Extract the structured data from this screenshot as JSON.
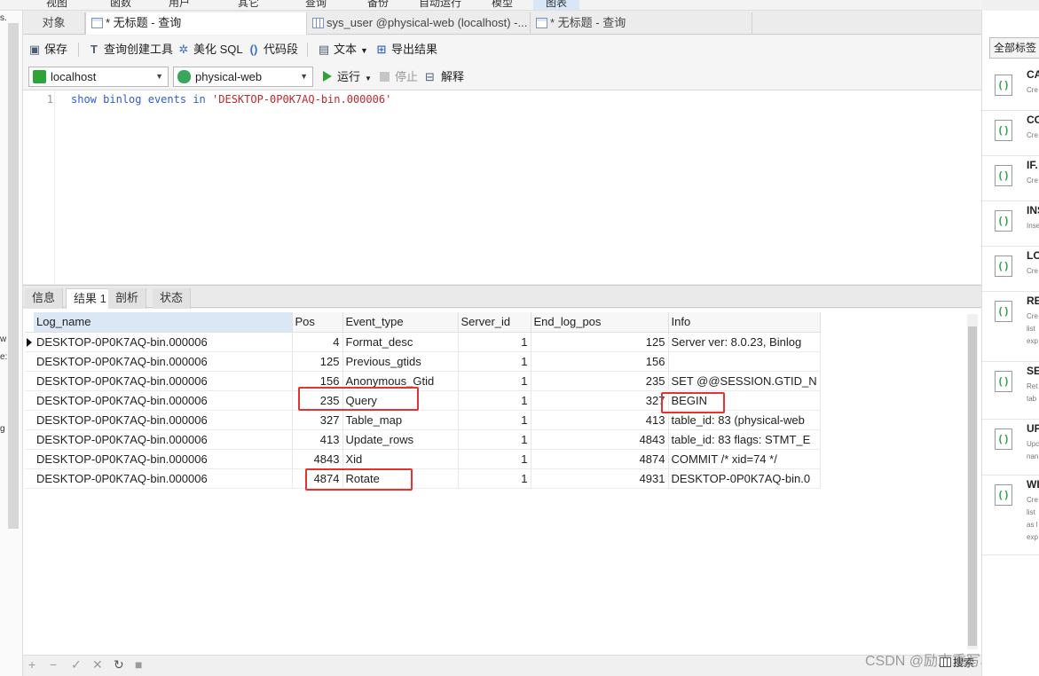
{
  "menu": [
    "视图",
    "函数",
    "用户",
    "其它",
    "查询",
    "备份",
    "自动运行",
    "模型",
    "图表"
  ],
  "tabs": [
    {
      "label": "对象"
    },
    {
      "label": "* 无标题 - 查询"
    },
    {
      "label": "sys_user @physical-web (localhost) -..."
    },
    {
      "label": "* 无标题 - 查询"
    }
  ],
  "toolbar": {
    "save": "保存",
    "query_builder": "查询创建工具",
    "beautify": "美化 SQL",
    "snippet": "代码段",
    "text": "文本",
    "export": "导出结果"
  },
  "connection": {
    "server": "localhost",
    "database": "physical-web",
    "run": "运行",
    "stop": "停止",
    "explain": "解释"
  },
  "editor": {
    "line_number": "1",
    "kw1": "show",
    "kw2": "binlog",
    "kw3": "events",
    "kw4": "in",
    "str": "'DESKTOP-0P0K7AQ-bin.000006'"
  },
  "result_tabs": [
    "信息",
    "结果 1",
    "剖析",
    "状态"
  ],
  "grid": {
    "columns": [
      "Log_name",
      "Pos",
      "Event_type",
      "Server_id",
      "End_log_pos",
      "Info"
    ],
    "rows": [
      [
        "DESKTOP-0P0K7AQ-bin.000006",
        "4",
        "Format_desc",
        "1",
        "125",
        "Server ver: 8.0.23, Binlog"
      ],
      [
        "DESKTOP-0P0K7AQ-bin.000006",
        "125",
        "Previous_gtids",
        "1",
        "156",
        ""
      ],
      [
        "DESKTOP-0P0K7AQ-bin.000006",
        "156",
        "Anonymous_Gtid",
        "1",
        "235",
        "SET @@SESSION.GTID_N"
      ],
      [
        "DESKTOP-0P0K7AQ-bin.000006",
        "235",
        "Query",
        "1",
        "327",
        "BEGIN"
      ],
      [
        "DESKTOP-0P0K7AQ-bin.000006",
        "327",
        "Table_map",
        "1",
        "413",
        "table_id: 83 (physical-web"
      ],
      [
        "DESKTOP-0P0K7AQ-bin.000006",
        "413",
        "Update_rows",
        "1",
        "4843",
        "table_id: 83 flags: STMT_E"
      ],
      [
        "DESKTOP-0P0K7AQ-bin.000006",
        "4843",
        "Xid",
        "1",
        "4874",
        "COMMIT /* xid=74 */"
      ],
      [
        "DESKTOP-0P0K7AQ-bin.000006",
        "4874",
        "Rotate",
        "1",
        "4931",
        "DESKTOP-0P0K7AQ-bin.0"
      ]
    ]
  },
  "right_panel": {
    "all_tags": "全部标签",
    "snippets": [
      {
        "title": "CA",
        "desc": "Cre"
      },
      {
        "title": "CO",
        "desc": "Cre"
      },
      {
        "title": "IF.",
        "desc": "Cre"
      },
      {
        "title": "INS",
        "desc": "Inse"
      },
      {
        "title": "LO",
        "desc": "Cre"
      },
      {
        "title": "RE",
        "desc": "Cre list exp"
      },
      {
        "title": "SE",
        "desc": "Ret tab"
      },
      {
        "title": "UP",
        "desc": "Upc nan"
      },
      {
        "title": "WI",
        "desc": "Cre list as l exp"
      }
    ],
    "search": "搜索"
  },
  "left_fragments": [
    "s.",
    "w",
    "e:",
    "g"
  ],
  "watermark": "CSDN @励志重写JDK",
  "colors": {
    "highlight": "#e53333",
    "run": "#2fa33a",
    "keyword": "#2f5bd6",
    "string": "#c0282c"
  }
}
